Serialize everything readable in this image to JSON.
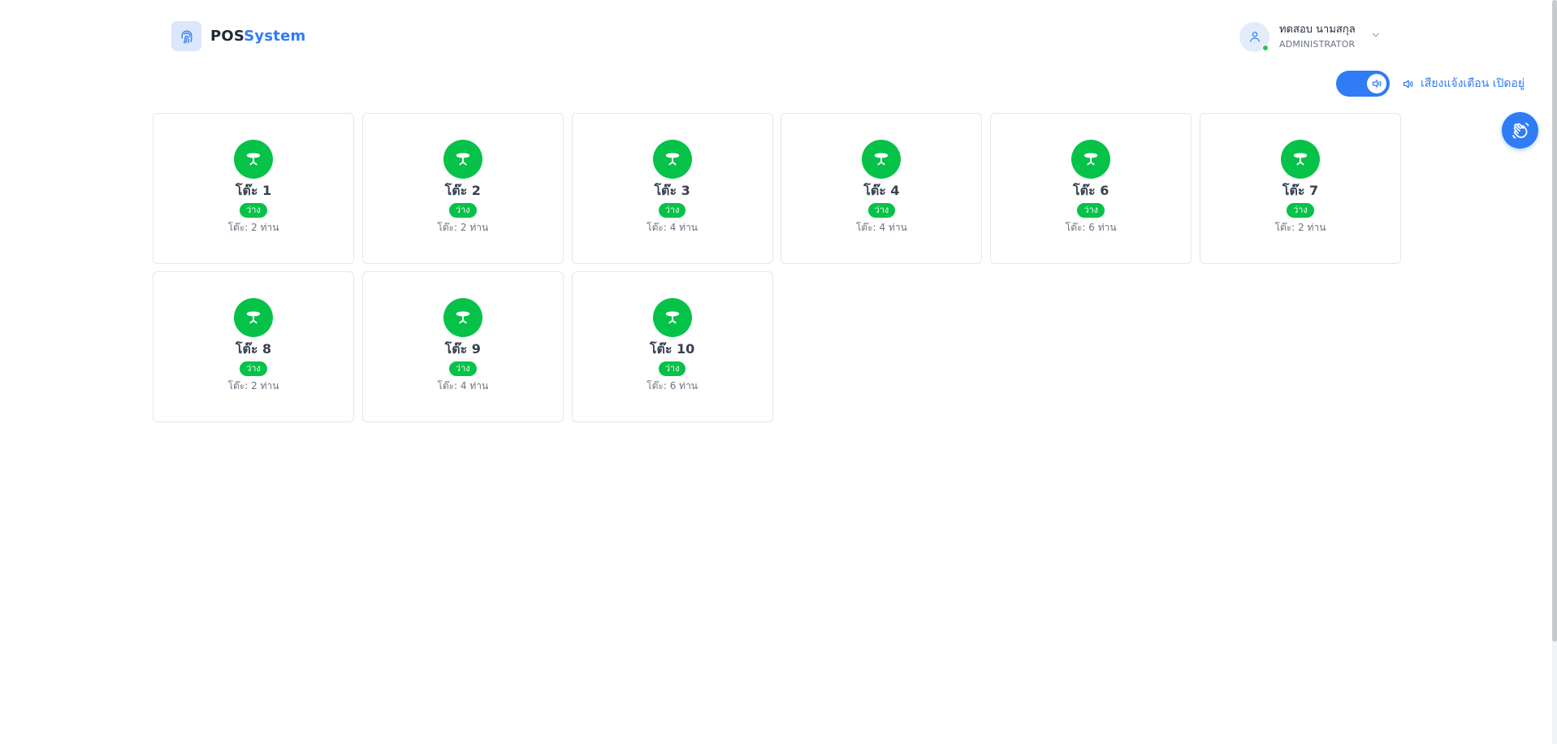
{
  "header": {
    "logo_part1": "POS",
    "logo_part2": "System",
    "logo_icon": "fingerprint-icon"
  },
  "user": {
    "name": "ทดสอบ นามสกุล",
    "role": "ADMINISTRATOR",
    "status_color": "#22c55e"
  },
  "sound": {
    "enabled": true,
    "label": "เสียงแจ้งเตือน เปิดอยู่"
  },
  "colors": {
    "accent": "#2f7cf6",
    "available": "#06c248"
  },
  "tables": [
    {
      "name": "โต๊ะ 1",
      "status": "ว่าง",
      "seats": "โต๊ะ: 2 ท่าน"
    },
    {
      "name": "โต๊ะ 2",
      "status": "ว่าง",
      "seats": "โต๊ะ: 2 ท่าน"
    },
    {
      "name": "โต๊ะ 3",
      "status": "ว่าง",
      "seats": "โต๊ะ: 4 ท่าน"
    },
    {
      "name": "โต๊ะ 4",
      "status": "ว่าง",
      "seats": "โต๊ะ: 4 ท่าน"
    },
    {
      "name": "โต๊ะ 6",
      "status": "ว่าง",
      "seats": "โต๊ะ: 6 ท่าน"
    },
    {
      "name": "โต๊ะ 7",
      "status": "ว่าง",
      "seats": "โต๊ะ: 2 ท่าน"
    },
    {
      "name": "โต๊ะ 8",
      "status": "ว่าง",
      "seats": "โต๊ะ: 2 ท่าน"
    },
    {
      "name": "โต๊ะ 9",
      "status": "ว่าง",
      "seats": "โต๊ะ: 4 ท่าน"
    },
    {
      "name": "โต๊ะ 10",
      "status": "ว่าง",
      "seats": "โต๊ะ: 6 ท่าน"
    }
  ]
}
